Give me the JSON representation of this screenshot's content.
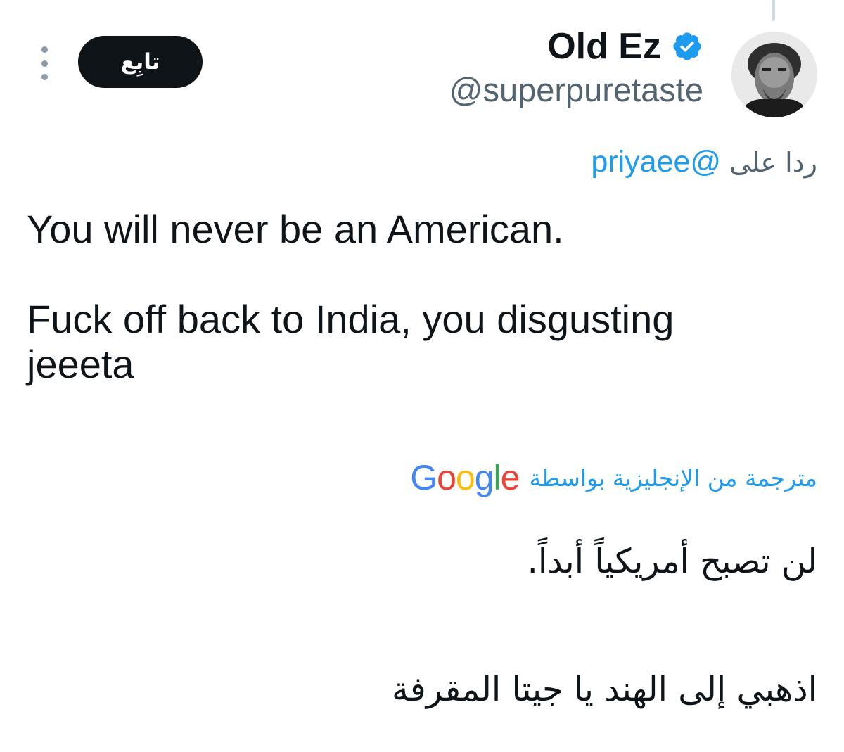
{
  "header": {
    "display_name": "Old Ez",
    "handle": "@superpuretaste",
    "follow_label": "تابِع",
    "verified": true,
    "avatar": "portrait-photo"
  },
  "reply": {
    "prefix": "ردا على",
    "mention": "@priyaee"
  },
  "tweet": {
    "text": "You will never be an American.\n\nFuck off back to India, you disgusting\njeeeta"
  },
  "translation": {
    "label": "مترجمة من الإنجليزية بواسطة",
    "provider": "Google",
    "line1": "لن تصبح أمريكياً أبداً.",
    "line2": "اذهبي إلى الهند يا جيتا المقرفة"
  },
  "colors": {
    "accent": "#1d9bf0",
    "text": "#0f1419",
    "secondary": "#536471",
    "button": "#0f1419"
  },
  "icons": {
    "more": "more-vertical-icon",
    "verified": "verified-badge-icon"
  }
}
